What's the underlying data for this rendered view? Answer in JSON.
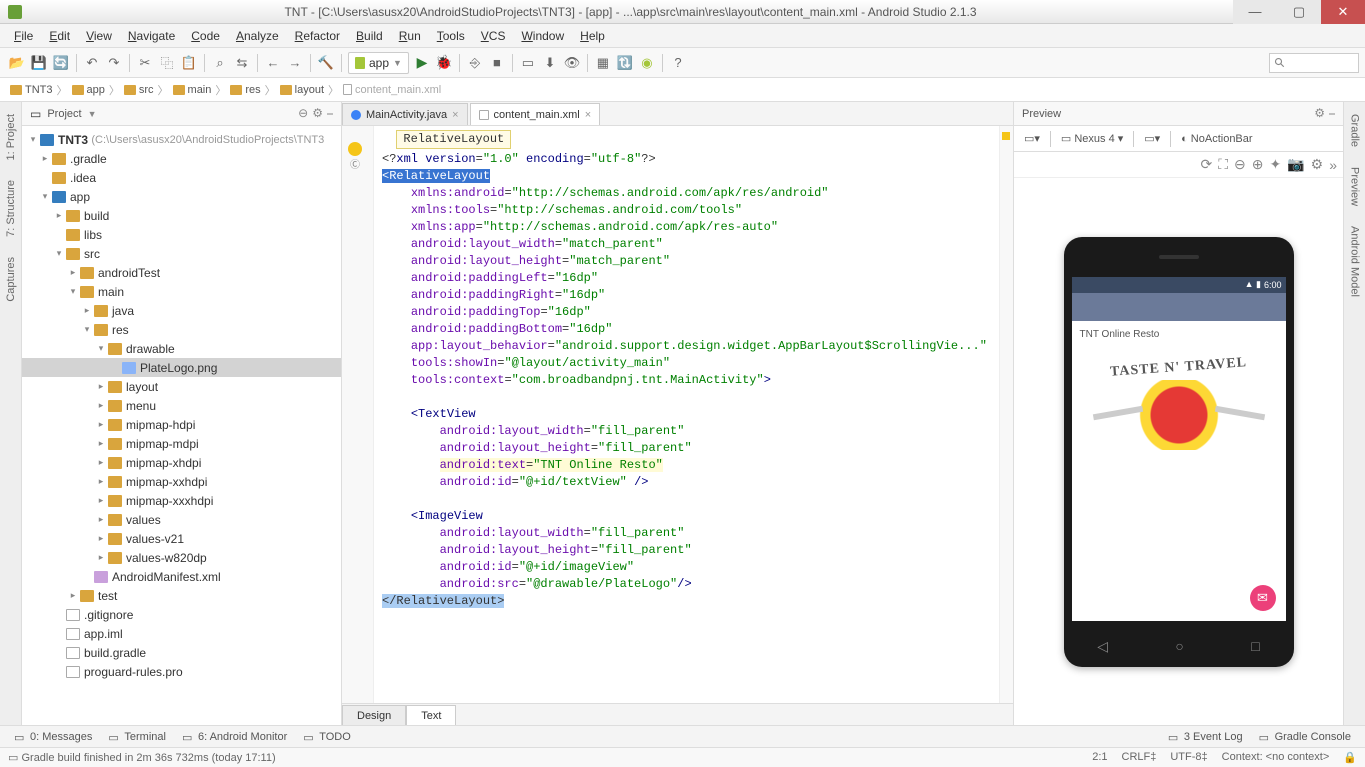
{
  "window": {
    "title": "TNT - [C:\\Users\\asusx20\\AndroidStudioProjects\\TNT3] - [app] - ...\\app\\src\\main\\res\\layout\\content_main.xml - Android Studio 2.1.3"
  },
  "menu": [
    "File",
    "Edit",
    "View",
    "Navigate",
    "Code",
    "Analyze",
    "Refactor",
    "Build",
    "Run",
    "Tools",
    "VCS",
    "Window",
    "Help"
  ],
  "run_config": "app",
  "search_ghost": "⌕",
  "breadcrumbs": [
    "TNT3",
    "app",
    "src",
    "main",
    "res",
    "layout",
    "content_main.xml"
  ],
  "left_gutter": [
    "1: Project",
    "7: Structure",
    "Captures"
  ],
  "right_gutter": [
    "Gradle",
    "Preview",
    "Android Model"
  ],
  "project_panel": {
    "title": "Project",
    "root": {
      "label": "TNT3",
      "dim": "(C:\\Users\\asusx20\\AndroidStudioProjects\\TNT3"
    },
    "nodes": [
      {
        "ind": 1,
        "tw": "▸",
        "ic": "fold",
        "lbl": ".gradle"
      },
      {
        "ind": 1,
        "tw": "",
        "ic": "fold",
        "lbl": ".idea"
      },
      {
        "ind": 1,
        "tw": "▾",
        "ic": "mod",
        "lbl": "app"
      },
      {
        "ind": 2,
        "tw": "▸",
        "ic": "fold",
        "lbl": "build"
      },
      {
        "ind": 2,
        "tw": "",
        "ic": "fold",
        "lbl": "libs"
      },
      {
        "ind": 2,
        "tw": "▾",
        "ic": "fold",
        "lbl": "src"
      },
      {
        "ind": 3,
        "tw": "▸",
        "ic": "fold",
        "lbl": "androidTest"
      },
      {
        "ind": 3,
        "tw": "▾",
        "ic": "fold",
        "lbl": "main"
      },
      {
        "ind": 4,
        "tw": "▸",
        "ic": "fold",
        "lbl": "java"
      },
      {
        "ind": 4,
        "tw": "▾",
        "ic": "fold",
        "lbl": "res"
      },
      {
        "ind": 5,
        "tw": "▾",
        "ic": "fold",
        "lbl": "drawable"
      },
      {
        "ind": 6,
        "tw": "",
        "ic": "png",
        "lbl": "PlateLogo.png",
        "sel": true
      },
      {
        "ind": 5,
        "tw": "▸",
        "ic": "fold",
        "lbl": "layout"
      },
      {
        "ind": 5,
        "tw": "▸",
        "ic": "fold",
        "lbl": "menu"
      },
      {
        "ind": 5,
        "tw": "▸",
        "ic": "fold",
        "lbl": "mipmap-hdpi"
      },
      {
        "ind": 5,
        "tw": "▸",
        "ic": "fold",
        "lbl": "mipmap-mdpi"
      },
      {
        "ind": 5,
        "tw": "▸",
        "ic": "fold",
        "lbl": "mipmap-xhdpi"
      },
      {
        "ind": 5,
        "tw": "▸",
        "ic": "fold",
        "lbl": "mipmap-xxhdpi"
      },
      {
        "ind": 5,
        "tw": "▸",
        "ic": "fold",
        "lbl": "mipmap-xxxhdpi"
      },
      {
        "ind": 5,
        "tw": "▸",
        "ic": "fold",
        "lbl": "values"
      },
      {
        "ind": 5,
        "tw": "▸",
        "ic": "fold",
        "lbl": "values-v21"
      },
      {
        "ind": 5,
        "tw": "▸",
        "ic": "fold",
        "lbl": "values-w820dp"
      },
      {
        "ind": 4,
        "tw": "",
        "ic": "xml",
        "lbl": "AndroidManifest.xml"
      },
      {
        "ind": 3,
        "tw": "▸",
        "ic": "fold",
        "lbl": "test"
      },
      {
        "ind": 2,
        "tw": "",
        "ic": "file",
        "lbl": ".gitignore"
      },
      {
        "ind": 2,
        "tw": "",
        "ic": "file",
        "lbl": "app.iml"
      },
      {
        "ind": 2,
        "tw": "",
        "ic": "file",
        "lbl": "build.gradle"
      },
      {
        "ind": 2,
        "tw": "",
        "ic": "file",
        "lbl": "proguard-rules.pro"
      }
    ]
  },
  "editor": {
    "tabs": [
      {
        "label": "MainActivity.java",
        "icon": "c",
        "active": false
      },
      {
        "label": "content_main.xml",
        "icon": "x",
        "active": true
      }
    ],
    "hint": "RelativeLayout",
    "bottom_tabs": [
      "Design",
      "Text"
    ],
    "active_bottom": "Text"
  },
  "preview": {
    "title": "Preview",
    "device": "Nexus 4",
    "theme": "NoActionBar",
    "app_title": "TNT Online Resto",
    "logo_text": "TASTE N' TRAVEL",
    "status_time": "6:00"
  },
  "bottom_tools": {
    "left": [
      "0: Messages",
      "Terminal",
      "6: Android Monitor",
      "TODO"
    ],
    "right": [
      "3  Event Log",
      "Gradle Console"
    ]
  },
  "status": {
    "msg": "Gradle build finished in 2m 36s 732ms (today 17:11)",
    "pos": "2:1",
    "eol": "CRLF",
    "enc": "UTF-8",
    "ctx": "Context: <no context>"
  }
}
